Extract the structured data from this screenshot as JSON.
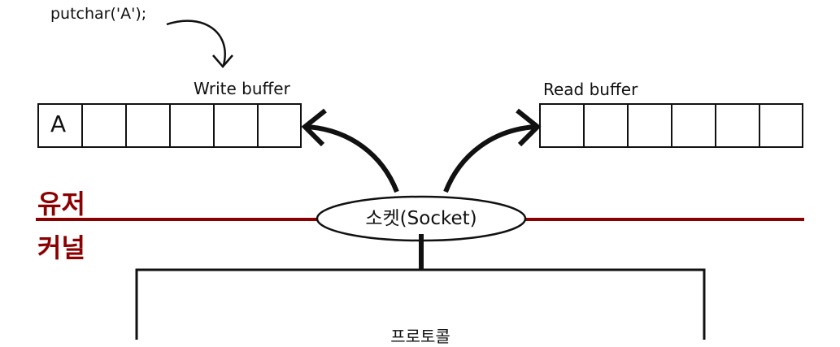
{
  "code_call": "putchar('A');",
  "write_buffer": {
    "label": "Write buffer",
    "cells": [
      "A",
      "",
      "",
      "",
      "",
      ""
    ]
  },
  "read_buffer": {
    "label": "Read buffer",
    "cells": [
      "",
      "",
      "",
      "",
      "",
      ""
    ]
  },
  "user_space_label": "유저",
  "kernel_space_label": "커널",
  "socket_label": "소켓(Socket)",
  "protocol_label": "프로토콜",
  "colors": {
    "boundary": "#8b0000",
    "ink": "#111111"
  }
}
